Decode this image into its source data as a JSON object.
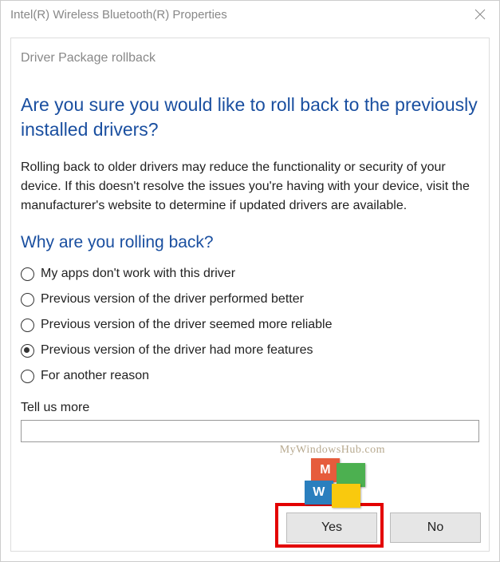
{
  "window": {
    "title": "Intel(R) Wireless Bluetooth(R) Properties"
  },
  "dialog": {
    "subtitle": "Driver Package rollback",
    "heading": "Are you sure you would like to roll back to the previously installed drivers?",
    "body": "Rolling back to older drivers may reduce the functionality or security of your device.  If this doesn't resolve the issues you're having with your device, visit the manufacturer's website to determine if updated drivers are available.",
    "subheading": "Why are you rolling back?",
    "options": [
      {
        "label": "My apps don't work with this driver",
        "checked": false
      },
      {
        "label": "Previous version of the driver performed better",
        "checked": false
      },
      {
        "label": "Previous version of the driver seemed more reliable",
        "checked": false
      },
      {
        "label": "Previous version of the driver had more features",
        "checked": true
      },
      {
        "label": "For another reason",
        "checked": false
      }
    ],
    "more_label": "Tell us more",
    "more_value": "",
    "yes": "Yes",
    "no": "No"
  },
  "watermark": {
    "text": "MyWindowsHub.com",
    "letters": [
      "M",
      "",
      "W",
      ""
    ]
  }
}
